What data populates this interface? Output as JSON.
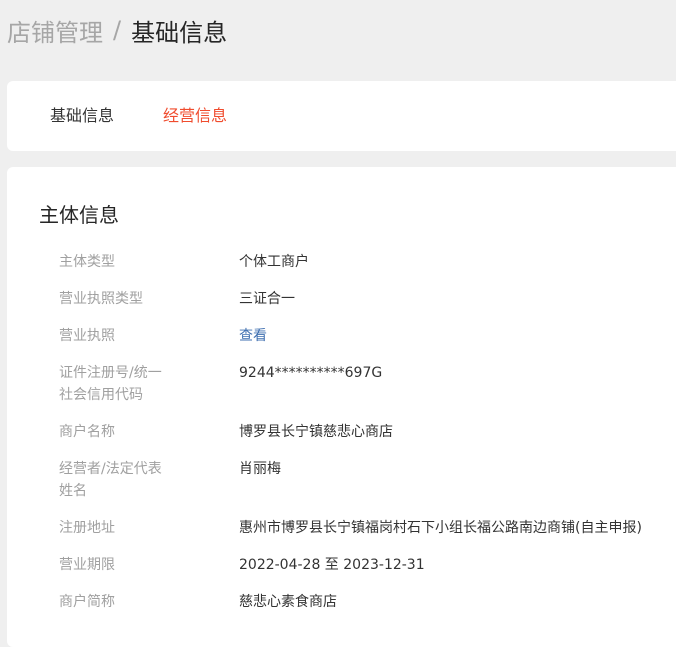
{
  "breadcrumb": {
    "parent": "店铺管理",
    "separator": "/",
    "current": "基础信息"
  },
  "tabs": [
    {
      "label": "基础信息",
      "active": false
    },
    {
      "label": "经营信息",
      "active": true
    }
  ],
  "colors": {
    "active_tab": "#f04c2e",
    "link": "#3f6fb0",
    "background": "#efefef"
  },
  "section": {
    "title": "主体信息",
    "fields": [
      {
        "label": "主体类型",
        "value": "个体工商户"
      },
      {
        "label": "营业执照类型",
        "value": "三证合一"
      },
      {
        "label": "营业执照",
        "value": "查看"
      },
      {
        "label": "证件注册号/统一社会信用代码",
        "value": "9244**********697G"
      },
      {
        "label": "商户名称",
        "value": "博罗县长宁镇慈悲心商店"
      },
      {
        "label": "经营者/法定代表姓名",
        "value": "肖丽梅"
      },
      {
        "label": "注册地址",
        "value": "惠州市博罗县长宁镇福岗村石下小组长福公路南边商铺(自主申报)"
      },
      {
        "label": "营业期限",
        "value": "2022-04-28 至 2023-12-31"
      },
      {
        "label": "商户简称",
        "value": "慈悲心素食商店"
      }
    ]
  }
}
